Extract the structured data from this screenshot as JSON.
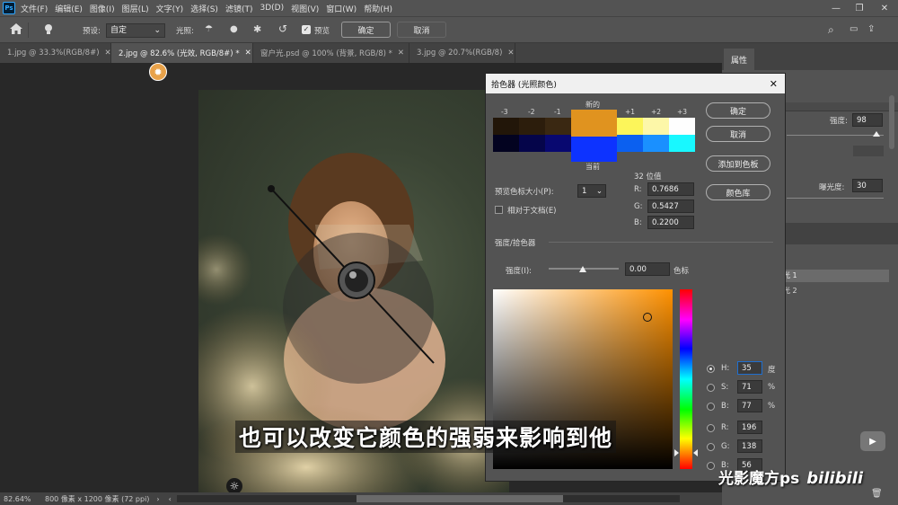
{
  "app": {
    "logo": "Ps"
  },
  "menu": [
    "文件(F)",
    "编辑(E)",
    "图像(I)",
    "图层(L)",
    "文字(Y)",
    "选择(S)",
    "滤镜(T)",
    "3D(D)",
    "视图(V)",
    "窗口(W)",
    "帮助(H)"
  ],
  "options": {
    "preset_label": "预设:",
    "preset_value": "自定",
    "light_label": "光照:",
    "preview_label": "预览",
    "ok": "确定",
    "cancel": "取消"
  },
  "tabs": [
    "1.jpg @ 33.3%(RGB/8#)",
    "2.jpg @ 82.6% (光效, RGB/8#) *",
    "窗户光.psd @ 100% (背景, RGB/8) *",
    "3.jpg @ 20.7%(RGB/8)"
  ],
  "status": {
    "zoom": "82.64%",
    "doc": "800 像素 x 1200 像素 (72 ppi)"
  },
  "right_panel": {
    "tab": "属性",
    "intensity_label": "强度:",
    "intensity_value": "98",
    "exposure_label": "曝光度:",
    "exposure_value": "30",
    "light1": "光 1",
    "light2": "光 2"
  },
  "dialog": {
    "title": "拾色器 (光照颜色)",
    "new_label": "新的",
    "current_label": "当前",
    "swatch_labels": [
      "-3",
      "-2",
      "-1",
      "+1",
      "+2",
      "+3"
    ],
    "top_colors": [
      "#221609",
      "#2c1d0c",
      "#3a2812",
      "#fcf55a",
      "#fdf7a8",
      "#fefefe"
    ],
    "bottom_colors": [
      "#030320",
      "#05054a",
      "#080870",
      "#0b60f0",
      "#1a90ff",
      "#18f8ff"
    ],
    "new_color": "#e0931f",
    "current_color": "#0d33ff",
    "ok": "确定",
    "cancel": "取消",
    "add_swatch": "添加到色板",
    "library": "颜色库",
    "preview_size_label": "预览色标大小(P):",
    "preview_size_value": "1",
    "relative_label": "相对于文档(E)",
    "bits_label": "32 位值",
    "r_float": "0.7686",
    "g_float": "0.5427",
    "b_float": "0.2200",
    "section_label": "强度/拾色器",
    "intensity_label": "强度(I):",
    "intensity_value": "0.00",
    "color_scale_label": "色标",
    "hsb": [
      {
        "label": "H:",
        "value": "35",
        "unit": "度"
      },
      {
        "label": "S:",
        "value": "71",
        "unit": "%"
      },
      {
        "label": "B:",
        "value": "77",
        "unit": "%"
      }
    ],
    "rgb": [
      {
        "label": "R:",
        "value": "196"
      },
      {
        "label": "G:",
        "value": "138"
      },
      {
        "label": "B:",
        "value": "56"
      }
    ]
  },
  "subtitle": "也可以改变它颜色的强弱来影响到他",
  "watermark": "光影魔方ps"
}
